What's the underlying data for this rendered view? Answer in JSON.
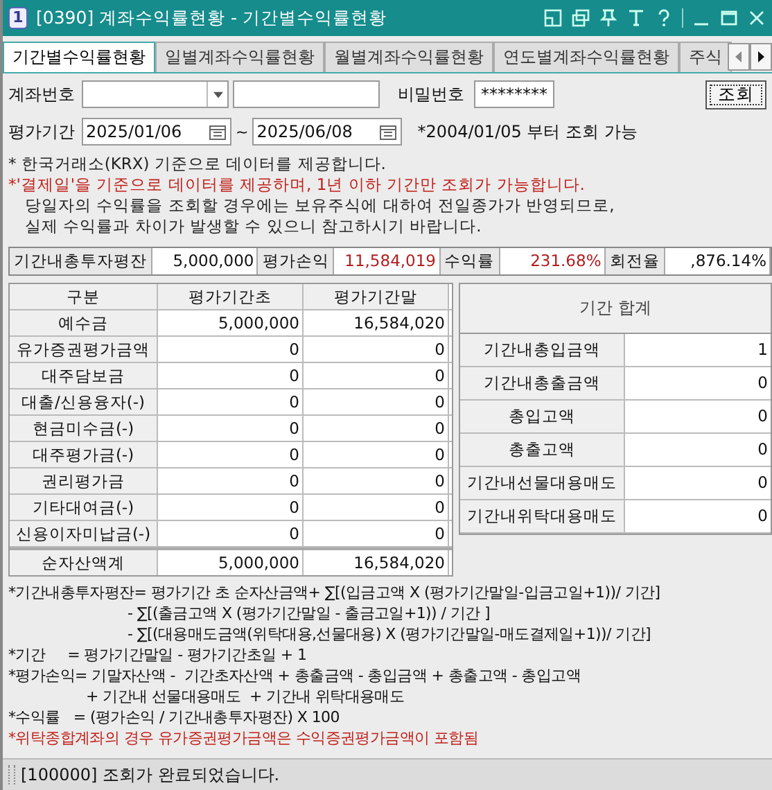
{
  "window": {
    "badge": "1",
    "title": "[0390] 계좌수익률현황 - 기간별수익률현황"
  },
  "tabs": [
    {
      "label": "기간별수익률현황",
      "selected": true
    },
    {
      "label": "일별계좌수익률현황",
      "selected": false
    },
    {
      "label": "월별계좌수익률현황",
      "selected": false
    },
    {
      "label": "연도별계좌수익률현황",
      "selected": false
    },
    {
      "label": "주식",
      "selected": false
    }
  ],
  "form": {
    "account_label": "계좌번호",
    "password_label": "비밀번호",
    "password_value": "********",
    "query_button": "조회",
    "period_label": "평가기간",
    "start_date": "2025/01/06",
    "separator": "~",
    "end_date": "2025/06/08",
    "period_hint": "*2004/01/05 부터 조회 가능"
  },
  "notes": [
    {
      "kind": "note",
      "text": "* 한국거래소(KRX) 기준으로 데이터를 제공합니다."
    },
    {
      "kind": "warning",
      "text": "*'결제일'을 기준으로 데이터를 제공하며, 1년 이하 기간만 조회가 가능합니다."
    },
    {
      "kind": "indent",
      "text": "당일자의 수익률을 조회할 경우에는 보유주식에 대하여 전일종가가 반영되므로,"
    },
    {
      "kind": "indent",
      "text": "실제 수익률과 차이가 발생할 수 있으니 참고하시기 바랍니다."
    }
  ],
  "summary": [
    {
      "label": "기간내총투자평잔",
      "value": "5,000,000",
      "highlight": false
    },
    {
      "label": "평가손익",
      "value": "11,584,019",
      "highlight": true
    },
    {
      "label": "수익률",
      "value": "231.68%",
      "highlight": true
    },
    {
      "label": "회전율",
      "value": ",876.14%",
      "highlight": false
    }
  ],
  "table": {
    "columns": [
      "구분",
      "평가기간초",
      "평가기간말"
    ],
    "rows": [
      [
        "예수금",
        "5,000,000",
        "16,584,020"
      ],
      [
        "유가증권평가금액",
        "0",
        "0"
      ],
      [
        "대주담보금",
        "0",
        "0"
      ],
      [
        "대출/신용융자(-)",
        "0",
        "0"
      ],
      [
        "현금미수금(-)",
        "0",
        "0"
      ],
      [
        "대주평가금(-)",
        "0",
        "0"
      ],
      [
        "권리평가금",
        "0",
        "0"
      ],
      [
        "기타대여금(-)",
        "0",
        "0"
      ],
      [
        "신용이자미납금(-)",
        "0",
        "0"
      ]
    ],
    "total": [
      "순자산액계",
      "5,000,000",
      "16,584,020"
    ]
  },
  "period_totals": {
    "title": "기간 합계",
    "rows": [
      [
        "기간내총입금액",
        "1"
      ],
      [
        "기간내총출금액",
        "0"
      ],
      [
        "총입고액",
        "0"
      ],
      [
        "총출고액",
        "0"
      ],
      [
        "기간내선물대용매도",
        "0"
      ],
      [
        "기간내위탁대용매도",
        "0"
      ]
    ]
  },
  "formulas": [
    {
      "kind": "main",
      "text": "*기간내총투자평잔= 평가기간 초 순자산금액+ ∑[(입금고액 X (평가기간말일-입금고일+1))/ 기간]"
    },
    {
      "kind": "deep_indent",
      "text": "- ∑[(출금고액 X (평가기간말일 - 출금고일+1)) / 기간 ]"
    },
    {
      "kind": "deep_indent",
      "text": "- ∑[(대용매도금액(위탁대용,선물대용) X (평가기간말일-매도결제일+1))/ 기간]"
    },
    {
      "kind": "main",
      "text": "*기간     = 평가기간말일 - 평가기간초일 + 1"
    },
    {
      "kind": "main",
      "text": "*평가손익= 기말자산액 -  기간초자산액 + 총출금액 - 총입금액 + 총출고액 - 총입고액"
    },
    {
      "kind": "indent",
      "text": "+ 기간내 선물대용매도  + 기간내 위탁대용매도"
    },
    {
      "kind": "main",
      "text": "*수익률   = (평가손익 / 기간내총투자평잔) X 100"
    },
    {
      "kind": "warning",
      "text": "*위탁종합계좌의 경우 유가증권평가금액은 수익증권평가금액이 포함됨"
    }
  ],
  "status_bar": "[100000] 조회가 완료되었습니다."
}
